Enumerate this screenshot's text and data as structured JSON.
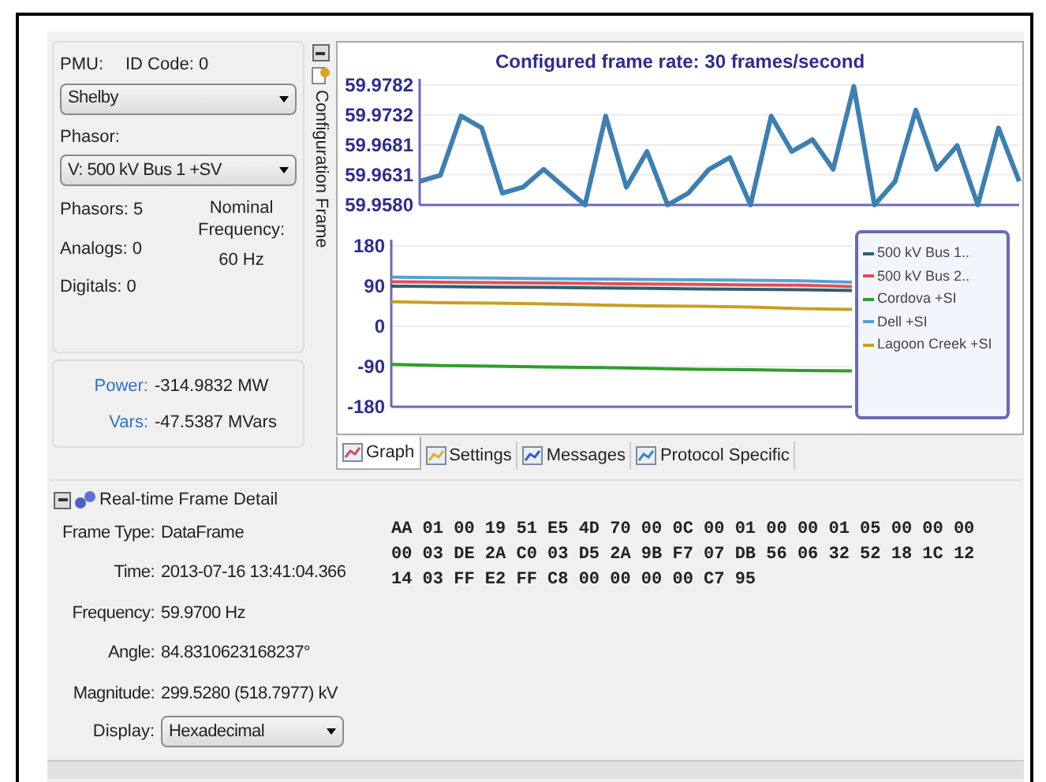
{
  "pmu": {
    "label": "PMU:",
    "id_code_label": "ID Code:",
    "id_code": "0",
    "value": "Shelby"
  },
  "phasor": {
    "label": "Phasor:",
    "value": "V: 500 kV Bus 1 +SV"
  },
  "counts": [
    {
      "label": "Phasors:",
      "value": "5"
    },
    {
      "label": "Analogs:",
      "value": "0"
    },
    {
      "label": "Digitals:",
      "value": "0"
    }
  ],
  "nominal_frequency": {
    "label": "Nominal Frequency:",
    "value": "60 Hz"
  },
  "measurements": [
    {
      "label": "Power:",
      "value": "-314.9832 MW"
    },
    {
      "label": "Vars:",
      "value": "-47.5387 MVars"
    }
  ],
  "side_tab": {
    "label": "Configuration Frame"
  },
  "graph": {
    "title": "Configured frame rate: 30 frames/second",
    "frequency_chart": {
      "chart_data": {
        "type": "line",
        "ylim": [
          59.958,
          59.9782
        ],
        "yticks": [
          {
            "value": 59.958,
            "label": "59.9580"
          },
          {
            "value": 59.9631,
            "label": "59.9631"
          },
          {
            "value": 59.9681,
            "label": "59.9681"
          },
          {
            "value": 59.9732,
            "label": "59.9732"
          },
          {
            "value": 59.9782,
            "label": "59.9782"
          }
        ],
        "grid": true,
        "series": [
          {
            "color": "#3f7fb0",
            "values": [
              59.962,
              59.963,
              59.973,
              59.971,
              59.96,
              59.961,
              59.964,
              59.961,
              59.958,
              59.973,
              59.961,
              59.967,
              59.958,
              59.96,
              59.964,
              59.966,
              59.958,
              59.973,
              59.967,
              59.969,
              59.964,
              59.978,
              59.958,
              59.962,
              59.974,
              59.964,
              59.968,
              59.958,
              59.971,
              59.962
            ]
          }
        ]
      }
    },
    "angle_chart": {
      "chart_data": {
        "type": "line",
        "ylim": [
          -180,
          180
        ],
        "yticks": [
          -180,
          -90,
          0,
          90,
          180
        ],
        "grid": true,
        "series": [
          {
            "name": "500 kV Bus 1..",
            "color": "#2f5f6f",
            "values": [
              90,
              89,
              88,
              87,
              86,
              85,
              84,
              83,
              82,
              80
            ]
          },
          {
            "name": "500 kV Bus 2..",
            "color": "#e0505a",
            "values": [
              100,
              99,
              98,
              97,
              96,
              95,
              94,
              93,
              92,
              89
            ]
          },
          {
            "name": "Cordova +SI",
            "color": "#2e9e2e",
            "values": [
              -85,
              -88,
              -89,
              -91,
              -92,
              -94,
              -96,
              -97,
              -99,
              -100
            ]
          },
          {
            "name": "Dell +SI",
            "color": "#5aa0d0",
            "values": [
              110,
              109,
              108,
              107,
              106,
              105,
              104,
              103,
              102,
              99
            ]
          },
          {
            "name": "Lagoon Creek +SI",
            "color": "#c8a020",
            "values": [
              55,
              53,
              52,
              50,
              48,
              46,
              45,
              43,
              40,
              38
            ]
          }
        ]
      }
    }
  },
  "tabs": [
    {
      "label": "Graph",
      "selected": true
    },
    {
      "label": "Settings",
      "selected": false
    },
    {
      "label": "Messages",
      "selected": false
    },
    {
      "label": "Protocol Specific",
      "selected": false
    }
  ],
  "frame_detail": {
    "title": "Real-time Frame Detail",
    "fields": [
      {
        "label": "Frame Type:",
        "value": "DataFrame"
      },
      {
        "label": "Time:",
        "value": "2013-07-16 13:41:04.366"
      },
      {
        "label": "Frequency:",
        "value": "59.9700 Hz"
      },
      {
        "label": "Angle:",
        "value": "84.8310623168237°"
      },
      {
        "label": "Magnitude:",
        "value": "299.5280 (518.7977) kV"
      }
    ],
    "display": {
      "label": "Display:",
      "value": "Hexadecimal"
    },
    "hex_lines": [
      "AA 01 00 19 51 E5 4D 70 00 0C 00 01 00 00 01 05 00 00 00",
      "00 03 DE 2A C0 03 D5 2A 9B F7 07 DB 56 06 32 52 18 1C 12",
      "14 03 FF E2 FF C8 00 00 00 00 C7 95"
    ]
  }
}
